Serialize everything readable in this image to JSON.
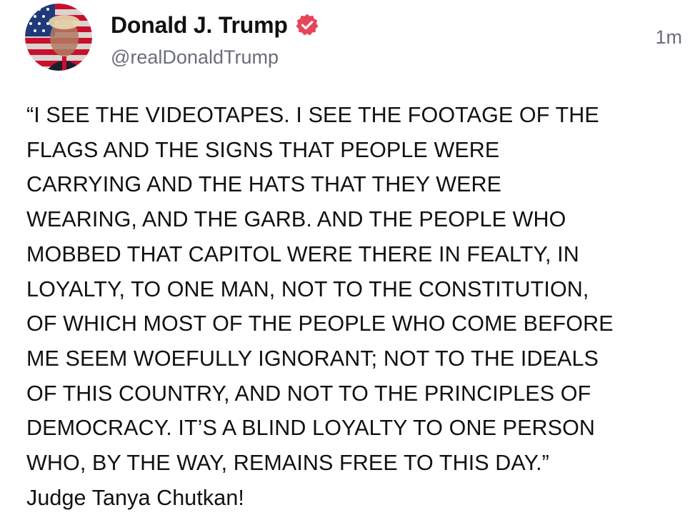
{
  "post": {
    "author": {
      "display_name": "Donald J. Trump",
      "handle": "@realDonaldTrump",
      "verified_icon": "verified-badge-icon",
      "avatar_icon": "profile-avatar"
    },
    "timestamp": "1m",
    "text_lines": [
      "“I SEE THE VIDEOTAPES. I SEE THE FOOTAGE OF THE",
      "FLAGS AND THE SIGNS THAT PEOPLE WERE",
      "CARRYING AND THE HATS THAT THEY WERE",
      "WEARING, AND THE GARB. AND THE PEOPLE WHO",
      "MOBBED THAT CAPITOL WERE THERE IN FEALTY, IN",
      "LOYALTY, TO ONE MAN, NOT TO THE CONSTITUTION,",
      "OF WHICH MOST OF THE PEOPLE WHO COME BEFORE",
      "ME SEEM WOEFULLY IGNORANT; NOT TO THE IDEALS",
      "OF THIS COUNTRY, AND NOT TO THE PRINCIPLES OF",
      "DEMOCRACY. IT’S A BLIND LOYALTY TO ONE PERSON",
      "WHO, BY THE WAY, REMAINS FREE TO THIS DAY.”",
      "Judge Tanya Chutkan!"
    ]
  },
  "colors": {
    "text": "#111111",
    "secondary_text": "#6b6e78",
    "verified_badge": "#e8445a",
    "background": "#ffffff"
  }
}
